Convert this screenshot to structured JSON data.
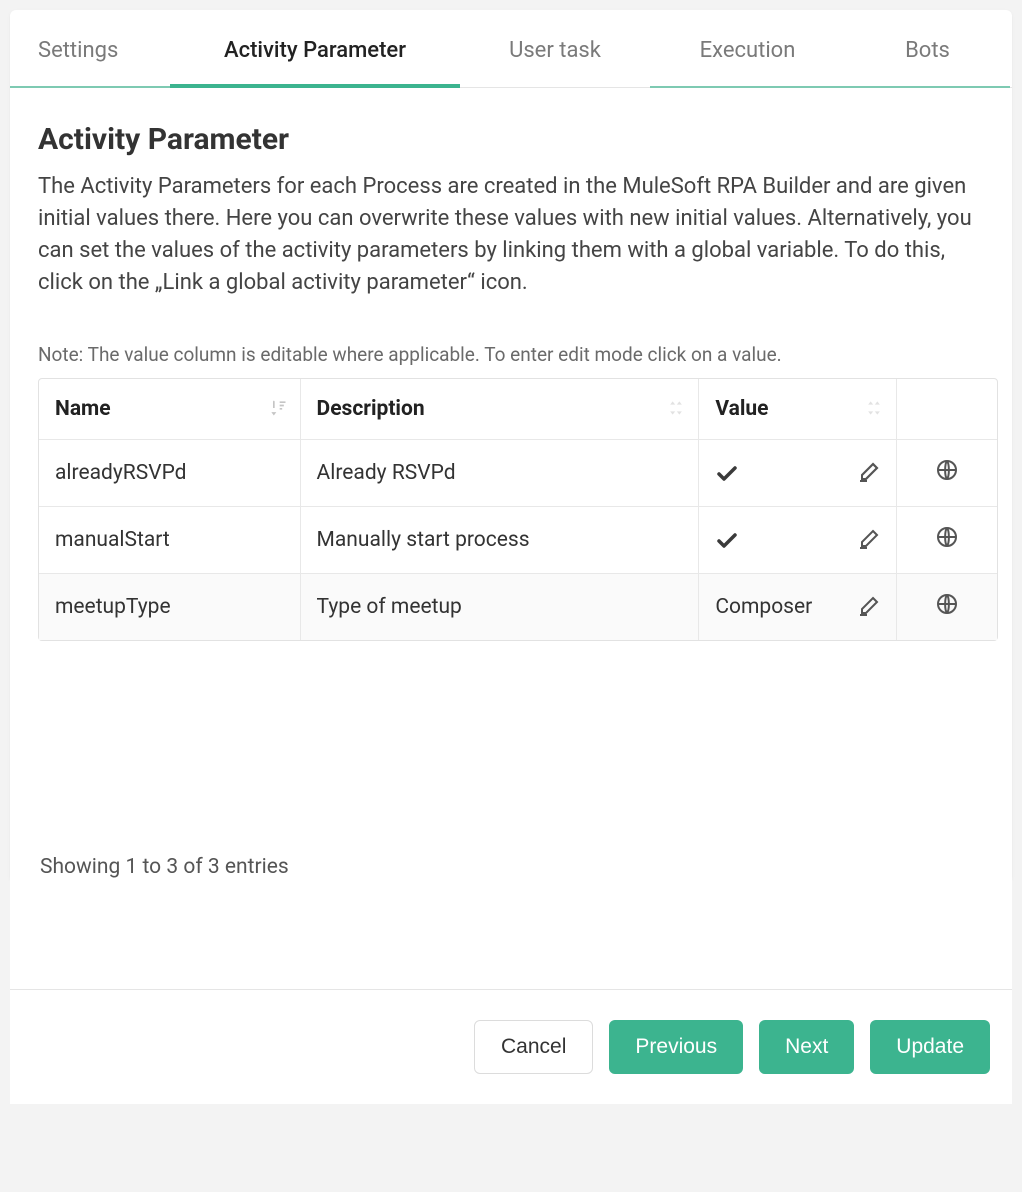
{
  "tabs": {
    "settings": "Settings",
    "activity": "Activity Parameter",
    "userTask": "User task",
    "execution": "Execution",
    "bots": "Bots"
  },
  "page": {
    "title": "Activity Parameter",
    "description": "The Activity Parameters for each Process are created in the MuleSoft RPA Builder and are given initial values there. Here you can overwrite these values with new initial values. Alternatively, you can set the values of the activity parameters by linking them with a global variable. To do this, click on the „Link a global activity parameter“ icon.",
    "note": "Note: The value column is editable where applicable. To enter edit mode click on a value."
  },
  "table": {
    "headers": {
      "name": "Name",
      "description": "Description",
      "value": "Value"
    },
    "rows": [
      {
        "name": "alreadyRSVPd",
        "description": "Already RSVPd",
        "valueType": "check",
        "value": ""
      },
      {
        "name": "manualStart",
        "description": "Manually start process",
        "valueType": "check",
        "value": ""
      },
      {
        "name": "meetupType",
        "description": "Type of meetup",
        "valueType": "text",
        "value": "Composer"
      }
    ],
    "entriesInfo": "Showing 1 to 3 of 3 entries"
  },
  "footer": {
    "cancel": "Cancel",
    "previous": "Previous",
    "next": "Next",
    "update": "Update"
  }
}
